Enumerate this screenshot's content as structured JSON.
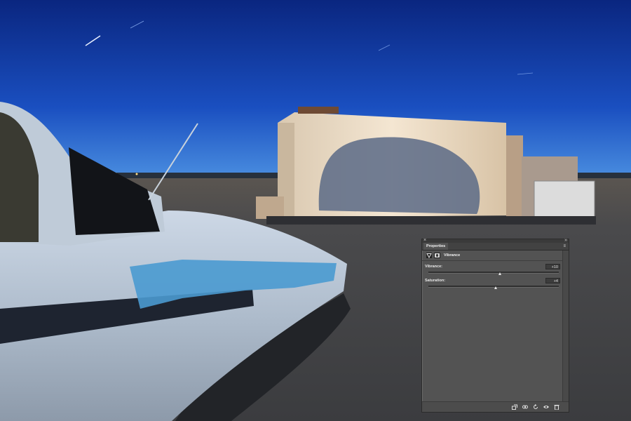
{
  "panel": {
    "tab_label": "Properties",
    "close_glyph": "×",
    "collapse_glyph": "»",
    "menu_glyph": "≡",
    "adjustment_icon": "vibrance-adjustment-icon",
    "mask_icon": "layer-mask-icon",
    "adjustment_title": "Vibrance",
    "vibrance": {
      "label": "Vibrance:",
      "value": "+10",
      "level": 0.55
    },
    "saturation": {
      "label": "Saturation:",
      "value": "+4",
      "level": 0.52
    },
    "footer_icons": [
      "clip-to-layer-icon",
      "view-previous-state-icon",
      "reset-icon",
      "visibility-eye-icon",
      "delete-trash-icon"
    ]
  },
  "colors": {
    "sky_top": "#0a2680",
    "sky_horizon": "#3d7fd8",
    "panel_bg": "#535353"
  }
}
